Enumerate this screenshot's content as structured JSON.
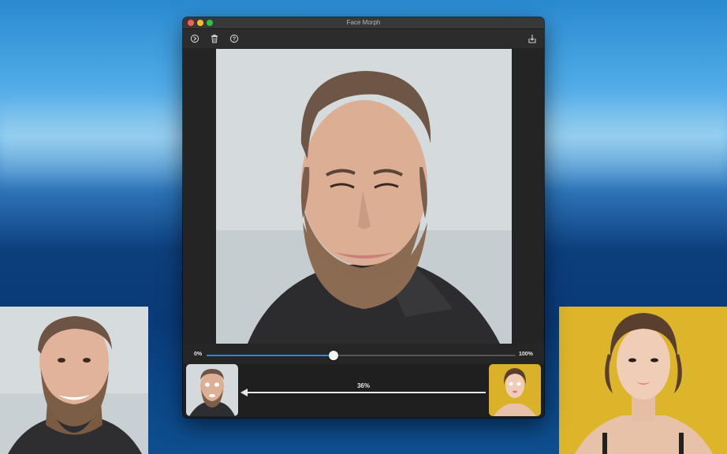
{
  "window": {
    "title": "Face Morph"
  },
  "toolbar": {
    "icons": [
      "settings-icon",
      "trash-icon",
      "help-icon",
      "export-icon"
    ]
  },
  "morph": {
    "min_label": "0%",
    "max_label": "100%",
    "slider_value": 0.41,
    "percent_label": "36%"
  },
  "colors": {
    "accent": "#2f86e8",
    "window_bg": "#262626",
    "right_backdrop": "#dcb52a"
  }
}
